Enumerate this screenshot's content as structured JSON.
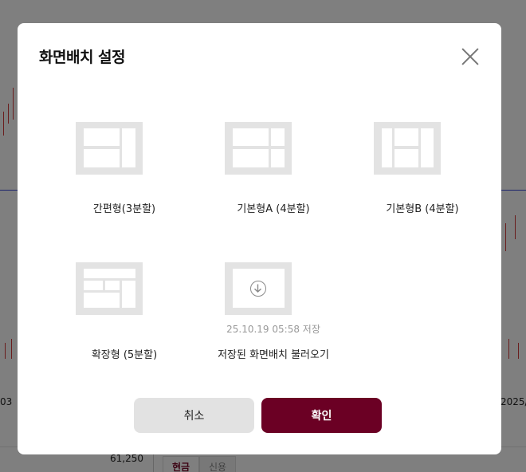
{
  "background": {
    "axis_left": "03",
    "axis_right": "2025/0",
    "price": "61,250",
    "tabs": [
      "현금",
      "신용"
    ]
  },
  "modal": {
    "title": "화면배치 설정",
    "options": [
      {
        "label": "간편형(3분할)"
      },
      {
        "label": "기본형A (4분할)"
      },
      {
        "label": "기본형B (4분할)"
      },
      {
        "label": "확장형 (5분할)"
      },
      {
        "label": "저장된 화면배치 불러오기",
        "saved_time": "25.10.19 05:58 저장"
      }
    ],
    "cancel_label": "취소",
    "confirm_label": "확인"
  },
  "colors": {
    "primary": "#6b0024",
    "thumb": "#e3e3e3",
    "overlay": "rgba(0,0,0,0.5)"
  }
}
